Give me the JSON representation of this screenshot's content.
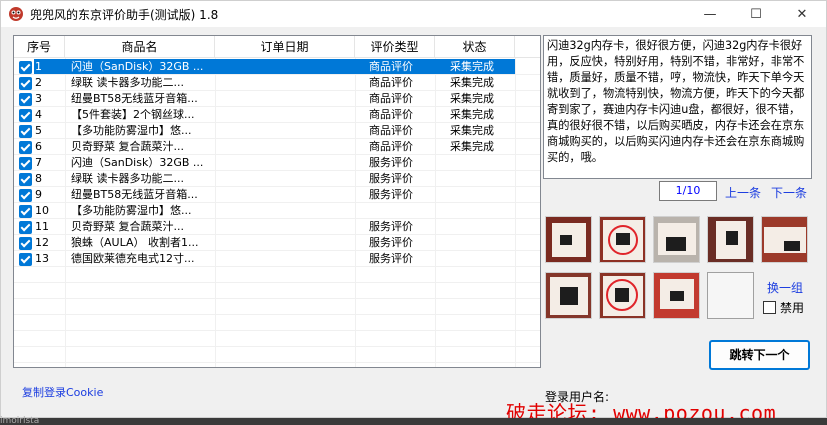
{
  "window": {
    "title": "兜兜风的东京评价助手(测试版) 1.8",
    "controls": {
      "minimize": "—",
      "maximize": "☐",
      "close": "✕"
    }
  },
  "table": {
    "headers": [
      "序号",
      "商品名",
      "订单日期",
      "评价类型",
      "状态"
    ],
    "selected_row": 0,
    "rows": [
      {
        "no": "1",
        "name": "闪迪（SanDisk）32GB ...",
        "date": "",
        "type": "商品评价",
        "status": "采集完成",
        "checked": true
      },
      {
        "no": "2",
        "name": "绿联 读卡器多功能二...",
        "date": "",
        "type": "商品评价",
        "status": "采集完成",
        "checked": true
      },
      {
        "no": "3",
        "name": "纽曼BT58无线蓝牙音箱...",
        "date": "",
        "type": "商品评价",
        "status": "采集完成",
        "checked": true
      },
      {
        "no": "4",
        "name": "【5件套装】2个钢丝球...",
        "date": "",
        "type": "商品评价",
        "status": "采集完成",
        "checked": true
      },
      {
        "no": "5",
        "name": "【多功能防雾湿巾】悠...",
        "date": "",
        "type": "商品评价",
        "status": "采集完成",
        "checked": true
      },
      {
        "no": "6",
        "name": "贝奇野菜 复合蔬菜汁...",
        "date": "",
        "type": "商品评价",
        "status": "采集完成",
        "checked": true
      },
      {
        "no": "7",
        "name": "闪迪（SanDisk）32GB ...",
        "date": "",
        "type": "服务评价",
        "status": "",
        "checked": true
      },
      {
        "no": "8",
        "name": "绿联 读卡器多功能二...",
        "date": "",
        "type": "服务评价",
        "status": "",
        "checked": true
      },
      {
        "no": "9",
        "name": "纽曼BT58无线蓝牙音箱...",
        "date": "",
        "type": "服务评价",
        "status": "",
        "checked": true
      },
      {
        "no": "10",
        "name": "【多功能防雾湿巾】悠...",
        "date": "",
        "type": "",
        "status": "",
        "checked": true
      },
      {
        "no": "11",
        "name": "贝奇野菜 复合蔬菜汁...",
        "date": "",
        "type": "服务评价",
        "status": "",
        "checked": true
      },
      {
        "no": "12",
        "name": "狼蛛（AULA） 收割者1...",
        "date": "",
        "type": "服务评价",
        "status": "",
        "checked": true
      },
      {
        "no": "13",
        "name": "德国欧莱德充电式12寸...",
        "date": "",
        "type": "服务评价",
        "status": "",
        "checked": true
      }
    ]
  },
  "review": {
    "text": "闪迪32g内存卡，很好很方便，闪迪32g内存卡很好用，反应快，特别好用，特别不错，非常好，非常不错，质量好，质量不错，哼，物流快，昨天下单今天就收到了，物流特别快，物流方便，昨天下的今天都寄到家了，赛迪内存卡闪迪u盘，都很好，很不错，真的很好很不错，以后购买晒皮，内存卡还会在京东商城购买的，以后购买闪迪内存卡还会在京东商城购买的，哦。",
    "page": "1/10",
    "prev_label": "上一条",
    "next_label": "下一条"
  },
  "images": {
    "swap_label": "换一组",
    "disable_label": "禁用",
    "thumb_count": 9
  },
  "actions": {
    "jump_next_label": "跳转下一个",
    "copy_cookie_label": "复制登录Cookie",
    "login_user_label": "登录用户名:"
  },
  "watermark": "破走论坛: www.pozou.com",
  "desktop_text": "imoirlsta",
  "colors": {
    "selection": "#0078d7",
    "link": "#1a3ce0",
    "watermark": "#e10000"
  }
}
